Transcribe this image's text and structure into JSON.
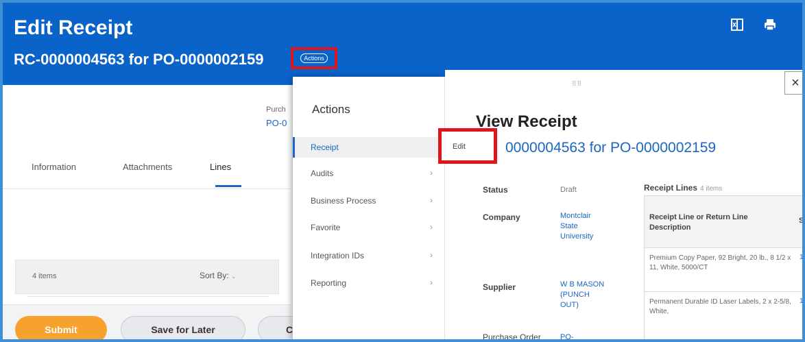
{
  "header": {
    "title": "Edit Receipt",
    "subtitle": "RC-0000004563 for PO-0000002159",
    "actions_label": "Actions",
    "icons": [
      "excel-export-icon",
      "print-icon"
    ]
  },
  "page": {
    "purchase_label": "Purch",
    "purchase_link": "PO-0",
    "tabs": [
      "Information",
      "Attachments",
      "Lines"
    ],
    "active_tab": "Lines",
    "list_count": "4 items",
    "sort_by": "Sort By:"
  },
  "footer": {
    "submit": "Submit",
    "save": "Save for Later",
    "cancel_partial": "C"
  },
  "actions_menu": {
    "title": "Actions",
    "items": [
      {
        "label": "Receipt",
        "chevron": ""
      },
      {
        "label": "Audits",
        "chevron": "›"
      },
      {
        "label": "Business Process",
        "chevron": "›"
      },
      {
        "label": "Favorite",
        "chevron": "›"
      },
      {
        "label": "Integration IDs",
        "chevron": "›"
      },
      {
        "label": "Reporting",
        "chevron": "›"
      }
    ]
  },
  "view_panel": {
    "title": "View Receipt",
    "subtitle": "0000004563 for PO-0000002159",
    "edit": "Edit",
    "close": "×",
    "drag": "⠿⠿",
    "fields": {
      "status_label": "Status",
      "status_value": "Draft",
      "company_label": "Company",
      "company_value": "Montclair State University",
      "supplier_label": "Supplier",
      "supplier_value": "W B MASON (PUNCH OUT)",
      "po_label": "Purchase Order",
      "po_value": "PO-"
    },
    "lines": {
      "heading": "Receipt Lines",
      "count": "4 items",
      "column": "Receipt Line or Return Line Description",
      "column_s": "S",
      "rows": [
        {
          "desc": "Premium Copy Paper, 92 Bright, 20 lb., 8 1/2 x 11, White, 5000/CT",
          "v": "1"
        },
        {
          "desc": "Permanent Durable ID Laser Labels, 2 x 2-5/8, White,",
          "v": "1"
        }
      ]
    }
  }
}
